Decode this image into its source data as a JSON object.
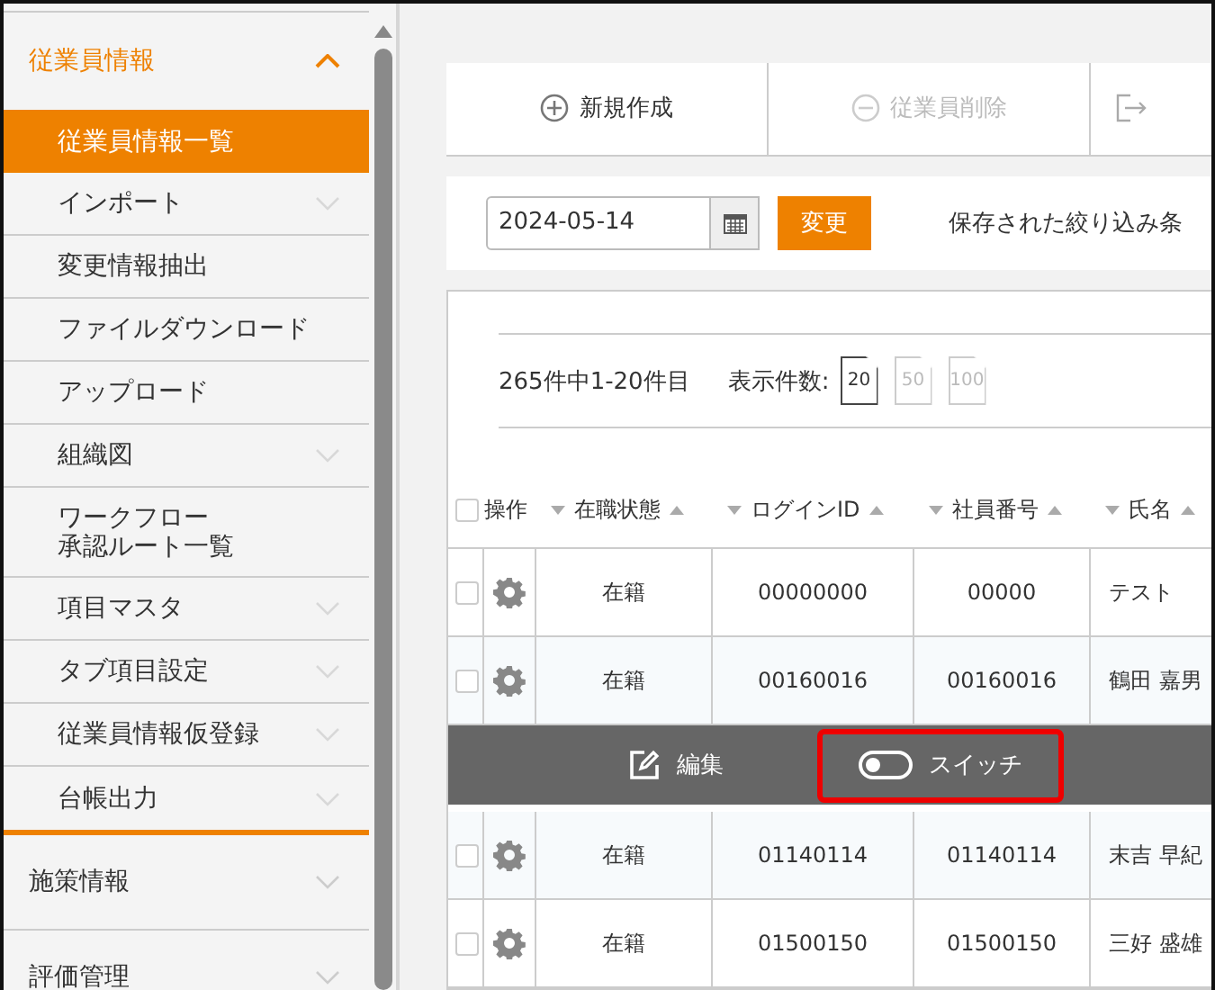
{
  "sidebar": {
    "sections": [
      {
        "label": "従業員情報",
        "expanded": true,
        "items": [
          {
            "label": "従業員情報一覧",
            "selected": true,
            "has_submenu": false
          },
          {
            "label": "インポート",
            "selected": false,
            "has_submenu": true
          },
          {
            "label": "変更情報抽出",
            "selected": false,
            "has_submenu": false
          },
          {
            "label": "ファイルダウンロード",
            "selected": false,
            "has_submenu": false
          },
          {
            "label": "アップロード",
            "selected": false,
            "has_submenu": false
          },
          {
            "label": "組織図",
            "selected": false,
            "has_submenu": true
          },
          {
            "label_lines": [
              "ワークフロー",
              "承認ルート一覧"
            ],
            "selected": false,
            "has_submenu": false
          },
          {
            "label": "項目マスタ",
            "selected": false,
            "has_submenu": true
          },
          {
            "label": "タブ項目設定",
            "selected": false,
            "has_submenu": true
          },
          {
            "label": "従業員情報仮登録",
            "selected": false,
            "has_submenu": true
          },
          {
            "label": "台帳出力",
            "selected": false,
            "has_submenu": true
          }
        ]
      },
      {
        "label": "施策情報",
        "expanded": false
      },
      {
        "label": "評価管理",
        "expanded": false
      }
    ]
  },
  "toolbar": {
    "buttons": [
      {
        "kind": "add",
        "label": "新規作成",
        "disabled": false
      },
      {
        "kind": "remove",
        "label": "従業員削除",
        "disabled": true
      },
      {
        "kind": "export",
        "disabled": false
      }
    ]
  },
  "filter": {
    "date": "2024-05-14",
    "apply_button": "変更",
    "saved_filters_label": "保存された絞り込み条"
  },
  "list": {
    "summary": "265件中1-20件目",
    "page_size_label": "表示件数:",
    "page_sizes": [
      {
        "label": "20",
        "selected": true
      },
      {
        "label": "50",
        "selected": false
      },
      {
        "label": "100",
        "selected": false
      }
    ]
  },
  "table": {
    "all_checked": false,
    "columns": [
      {
        "label": "操作",
        "sortable": false
      },
      {
        "label": "在職状態",
        "sortable": true
      },
      {
        "label": "ログインID",
        "sortable": true
      },
      {
        "label": "社員番号",
        "sortable": true
      },
      {
        "label": "氏名",
        "sortable": true
      }
    ],
    "rows": [
      {
        "kind": "row",
        "checked": false,
        "status": "在籍",
        "login_id": "00000000",
        "employee_no": "00000",
        "name": "テスト"
      },
      {
        "kind": "row",
        "checked": false,
        "status": "在籍",
        "login_id": "00160016",
        "employee_no": "00160016",
        "name": "鶴田 嘉男"
      },
      {
        "kind": "actions",
        "actions": [
          {
            "kind": "edit",
            "label": "編集",
            "highlighted": false
          },
          {
            "kind": "switch",
            "label": "スイッチ",
            "highlighted": true
          }
        ]
      },
      {
        "kind": "row",
        "checked": false,
        "status": "在籍",
        "login_id": "01140114",
        "employee_no": "01140114",
        "name": "末吉 早紀"
      },
      {
        "kind": "row",
        "checked": false,
        "status": "在籍",
        "login_id": "01500150",
        "employee_no": "01500150",
        "name": "三好 盛雄"
      }
    ]
  }
}
